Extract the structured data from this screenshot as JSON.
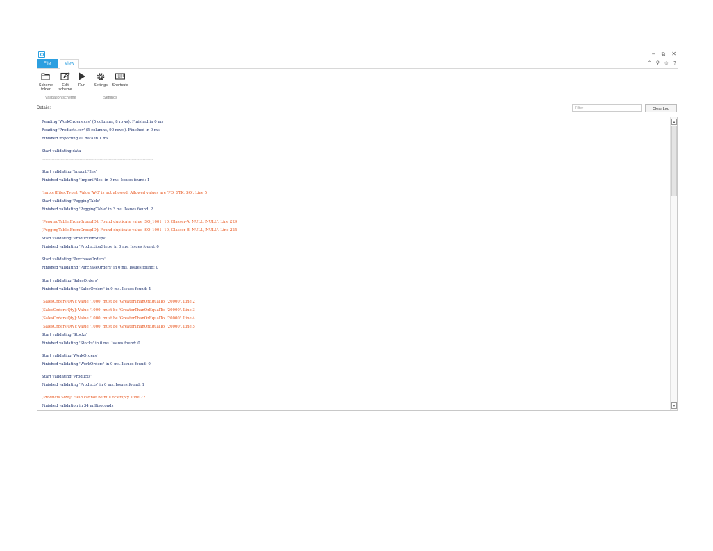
{
  "window": {
    "min": "–",
    "restore": "⧉",
    "close": "✕"
  },
  "tabs": {
    "file": "File",
    "view": "View"
  },
  "ribbon_right": {
    "up": "⌃",
    "settings": "⚲",
    "smile": "☺",
    "help": "?"
  },
  "ribbon": {
    "scheme_folder": "Scheme folder",
    "edit_scheme": "Edit scheme",
    "run": "Run",
    "settings": "Settings",
    "shortcuts": "Shortcuts",
    "group_validation": "Validation scheme",
    "group_settings": "Settings"
  },
  "details_label": "Details:",
  "filter_placeholder": "Filter",
  "clear_log": "Clear Log",
  "log": [
    {
      "t": "Reading 'WorkOrders.csv' (5 columns, 8 rows). Finished in 0 ms",
      "k": "info"
    },
    {
      "t": "Reading 'Products.csv' (5 columns, 90 rows). Finished in 0 ms",
      "k": "info"
    },
    {
      "t": "Finished importing all data in 1 ms",
      "k": "info"
    },
    {
      "t": "Start validating data",
      "k": "info"
    },
    {
      "t": "----------------------------------------------------------------------------------------",
      "k": "sepline"
    },
    {
      "t": "Start validating 'ImportFiles'",
      "k": "info"
    },
    {
      "t": "Finished validating 'ImportFiles' in 0 ms. Issues found: 1",
      "k": "info"
    },
    {
      "t": "[ImportFiles.Type]: Value 'WO' is not allowed. Allowed values are 'PO, STK, SO'. Line 5",
      "k": "err"
    },
    {
      "t": "Start validating 'PeggingTable'",
      "k": "info"
    },
    {
      "t": "Finished validating 'PeggingTable' in 3 ms. Issues found: 2",
      "k": "info"
    },
    {
      "t": "[PeggingTable.FromGroupID]: Found duplicate value 'SO_1001, 10, Glasser-A, NULL, NULL'. Line 229",
      "k": "err"
    },
    {
      "t": "[PeggingTable.FromGroupID]: Found duplicate value 'SO_1001, 10, Glasser-B, NULL, NULL'. Line 225",
      "k": "err"
    },
    {
      "t": "Start validating 'ProductionSteps'",
      "k": "info"
    },
    {
      "t": "Finished validating 'ProductionSteps' in 0 ms. Issues found: 0",
      "k": "info"
    },
    {
      "t": "Start validating 'PurchaseOrders'",
      "k": "info"
    },
    {
      "t": "Finished validating 'PurchaseOrders' in 0 ms. Issues found: 0",
      "k": "info"
    },
    {
      "t": "Start validating 'SalesOrders'",
      "k": "info"
    },
    {
      "t": "Finished validating 'SalesOrders' in 0 ms. Issues found: 4",
      "k": "info"
    },
    {
      "t": "[SalesOrders.Qty]: Value '1000' must be 'GreaterThanOrEqualTo' '20000'. Line 2",
      "k": "err"
    },
    {
      "t": "[SalesOrders.Qty]: Value '1000' must be 'GreaterThanOrEqualTo' '20000'. Line 3",
      "k": "err"
    },
    {
      "t": "[SalesOrders.Qty]: Value '1000' must be 'GreaterThanOrEqualTo' '20000'. Line 4",
      "k": "err"
    },
    {
      "t": "[SalesOrders.Qty]: Value '1000' must be 'GreaterThanOrEqualTo' '20000'. Line 5",
      "k": "err"
    },
    {
      "t": "Start validating 'Stocks'",
      "k": "info"
    },
    {
      "t": "Finished validating 'Stocks' in 0 ms. Issues found: 0",
      "k": "info"
    },
    {
      "t": "Start validating 'WorkOrders'",
      "k": "info"
    },
    {
      "t": "Finished validating 'WorkOrders' in 0 ms. Issues found: 0",
      "k": "info"
    },
    {
      "t": "Start validating 'Products'",
      "k": "info"
    },
    {
      "t": "Finished validating 'Products' in 0 ms. Issues found: 1",
      "k": "info"
    },
    {
      "t": "[Products.Size]: Field cannot be null or empty. Line 22",
      "k": "err"
    },
    {
      "t": "Finished validation in 34 milliseconds",
      "k": "info"
    }
  ]
}
